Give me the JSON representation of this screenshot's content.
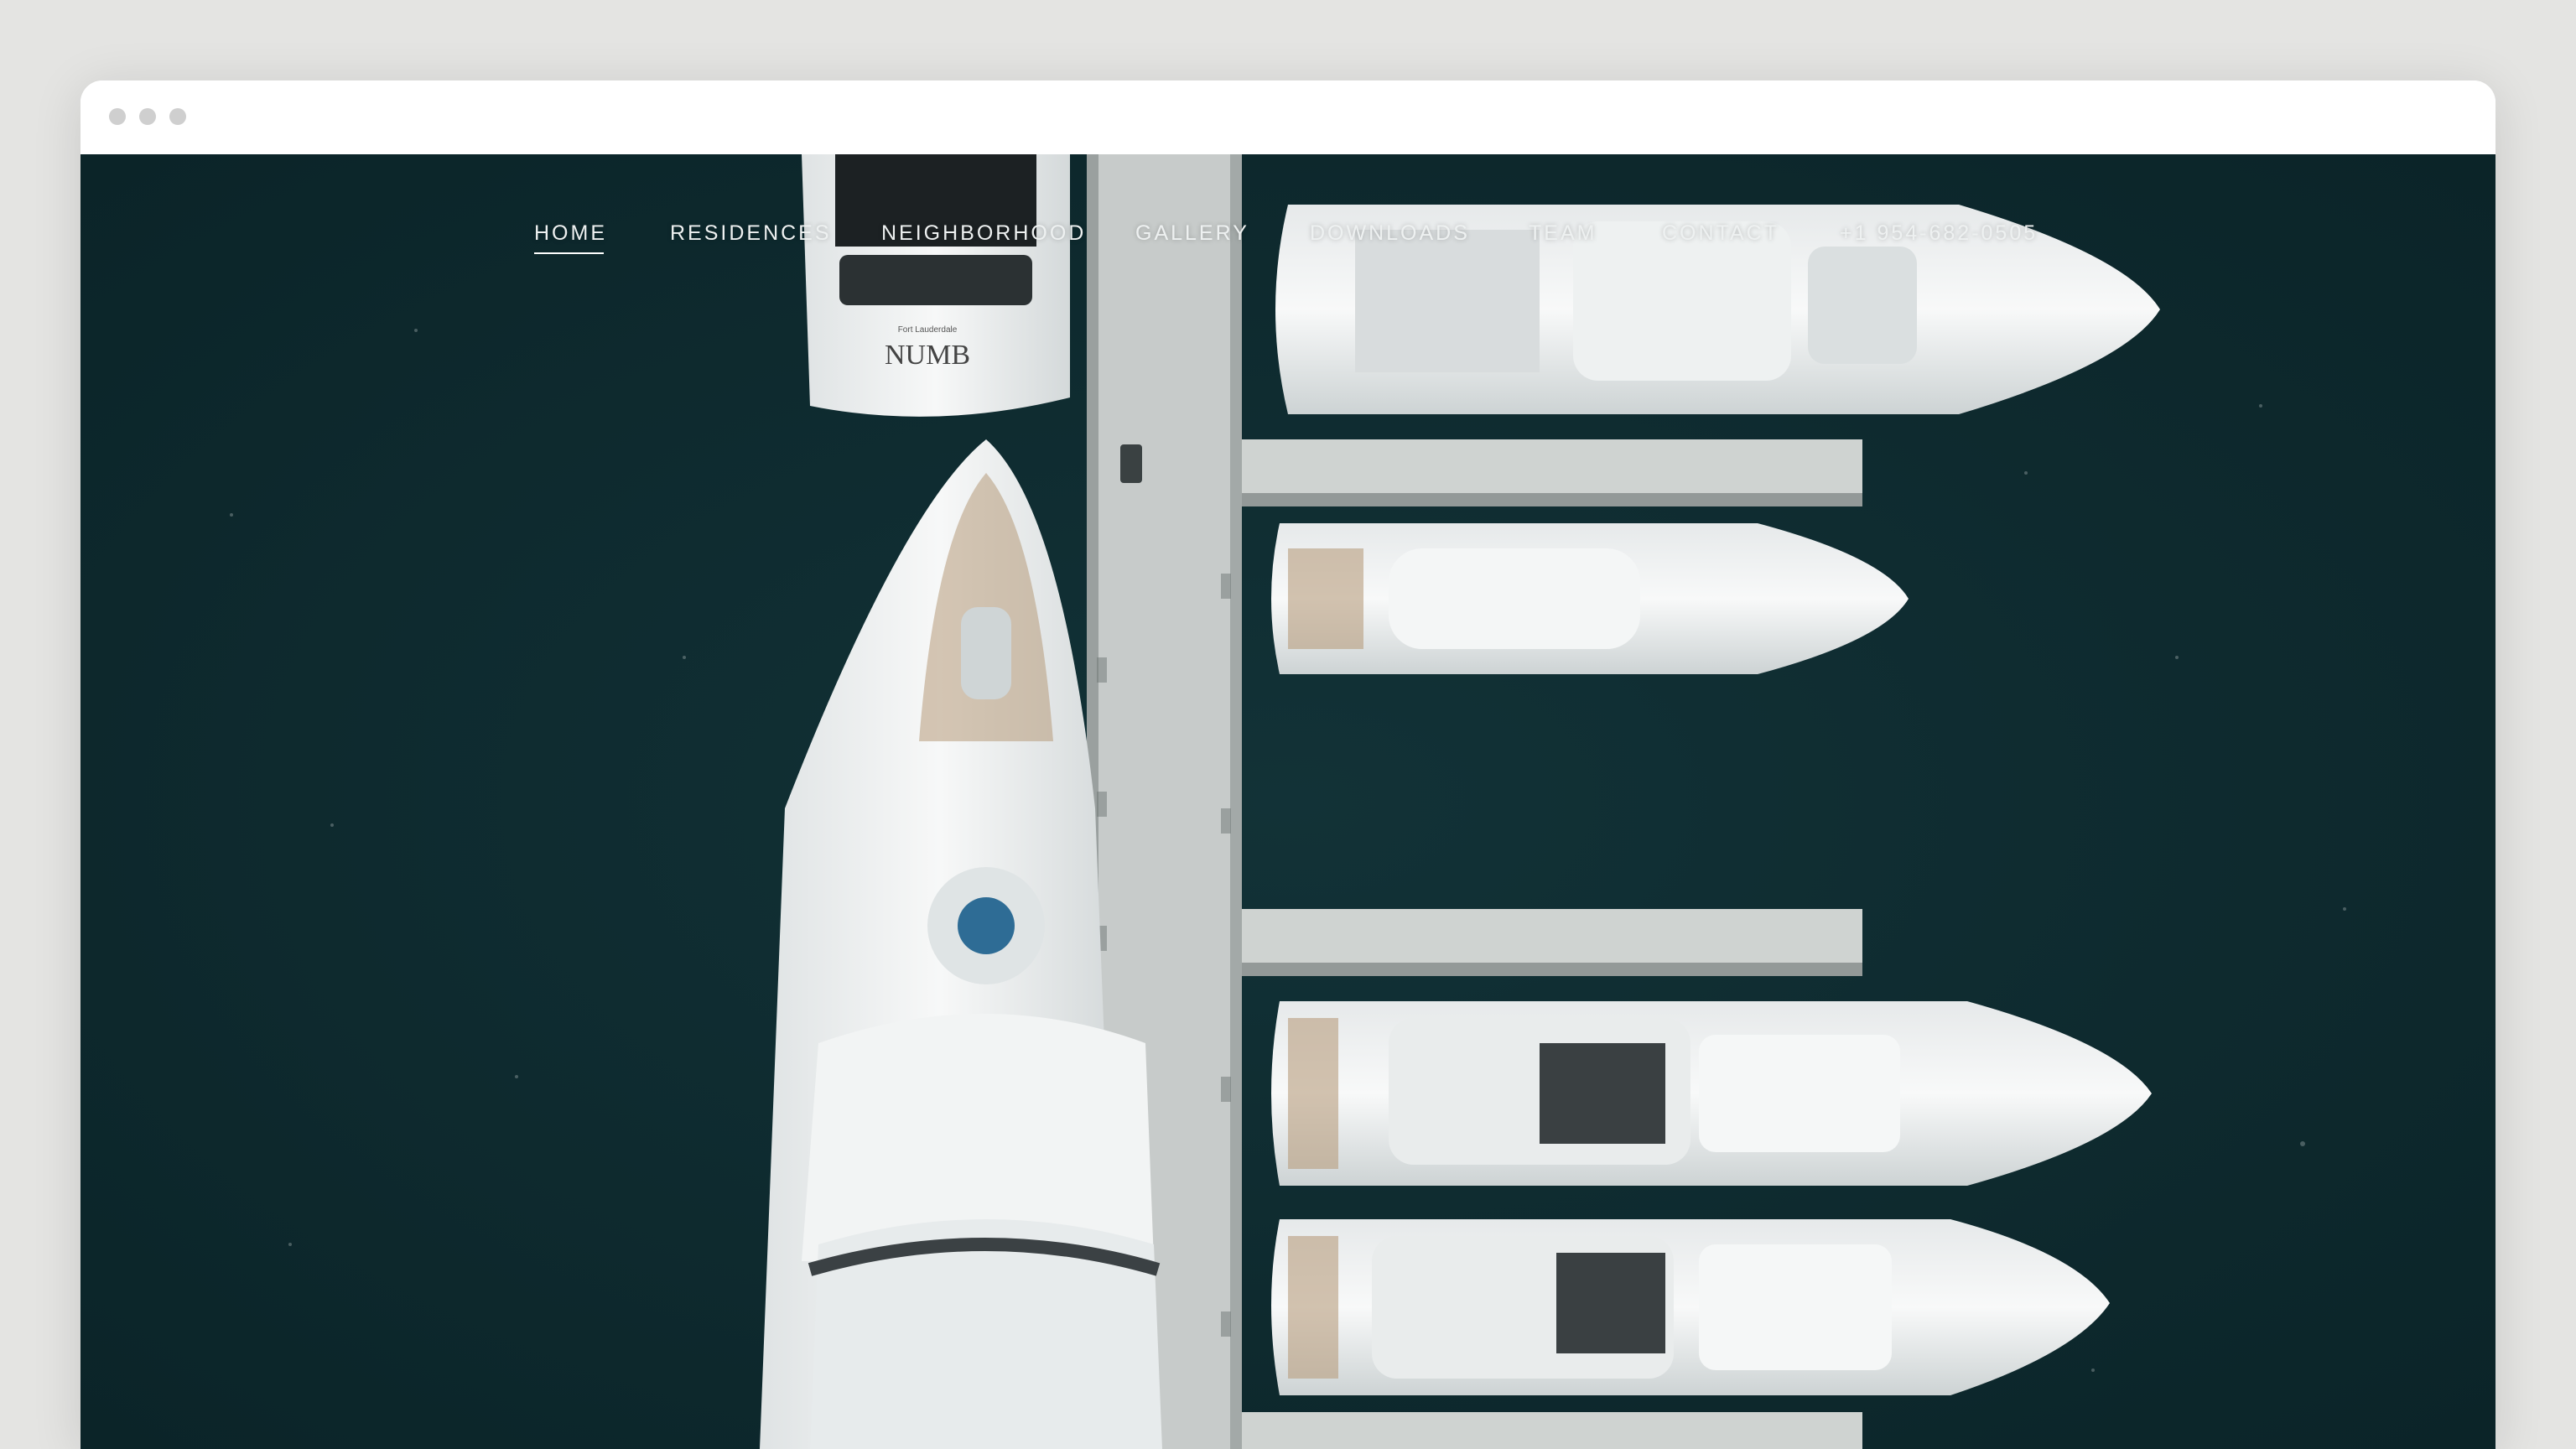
{
  "nav": {
    "items": [
      {
        "label": "HOME",
        "active": true
      },
      {
        "label": "RESIDENCES",
        "active": false
      },
      {
        "label": "NEIGHBORHOOD",
        "active": false
      },
      {
        "label": "GALLERY",
        "active": false
      },
      {
        "label": "DOWNLOADS",
        "active": false
      },
      {
        "label": "TEAM",
        "active": false
      },
      {
        "label": "CONTACT",
        "active": false
      }
    ],
    "phone": "+1 954-682-0505"
  },
  "hero": {
    "boat_name": "NUMB",
    "boat_port": "Fort Lauderdale"
  },
  "colors": {
    "water": "#0e2a2e",
    "dock": "#c9cccb",
    "hull": "#f1f3f3"
  }
}
